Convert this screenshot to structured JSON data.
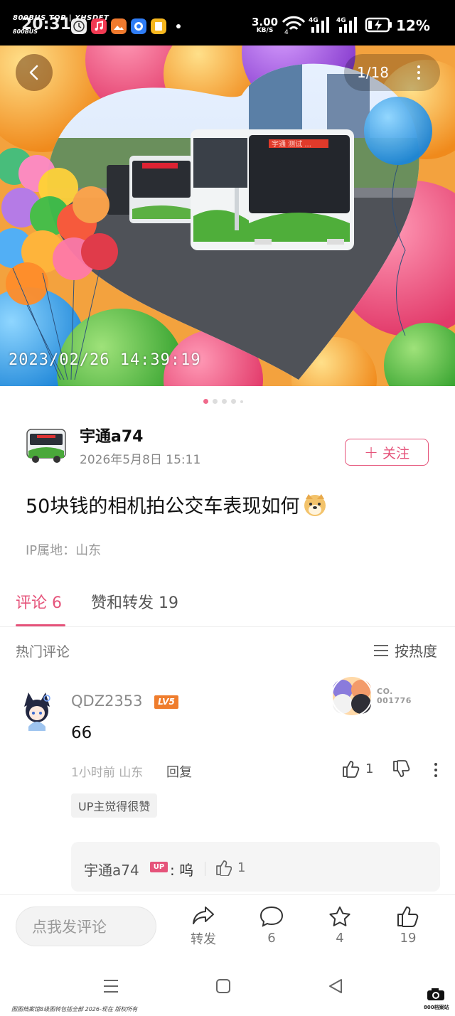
{
  "status_bar": {
    "watermark_top": "800BUS TOP | XHSDFT",
    "watermark_bottom": "800BUS",
    "time": "20:31",
    "net_speed": "3.00",
    "net_unit": "KB/S",
    "battery": "12%"
  },
  "hero": {
    "page_indicator": "1/18",
    "photo_timestamp": "2023/02/26  14:39:19",
    "bus_display": "宇通  测试  ..."
  },
  "author": {
    "name": "宇通a74",
    "date": "2026年5月8日 15:11",
    "follow_label": "关注"
  },
  "post": {
    "title": "50块钱的相机拍公交车表现如何",
    "ip_location": "IP属地：山东"
  },
  "tabs": {
    "comments": "评论 6",
    "likes_shares": "赞和转发 19"
  },
  "comments_header": {
    "hot": "热门评论",
    "sort": "按热度"
  },
  "comment": {
    "user": "QDZ2353",
    "level": "LV5",
    "medal_text_1": "CO.",
    "medal_text_2": "001776",
    "text": "66",
    "meta": "1小时前 山东",
    "reply_label": "回复",
    "likes": "1",
    "up_liked": "UP主觉得很赞",
    "reply": {
      "user": "宇通a74",
      "tag": "UP",
      "text": ": 呜",
      "likes": "1"
    }
  },
  "bottom_bar": {
    "input_placeholder": "点我发评论",
    "share_label": "转发",
    "comment_count": "6",
    "star_count": "4",
    "like_count": "19"
  },
  "footer": {
    "watermark": "图图档案馆8级图转包括全部  2026-现在 版权所有",
    "logo_text": "800档案站"
  }
}
